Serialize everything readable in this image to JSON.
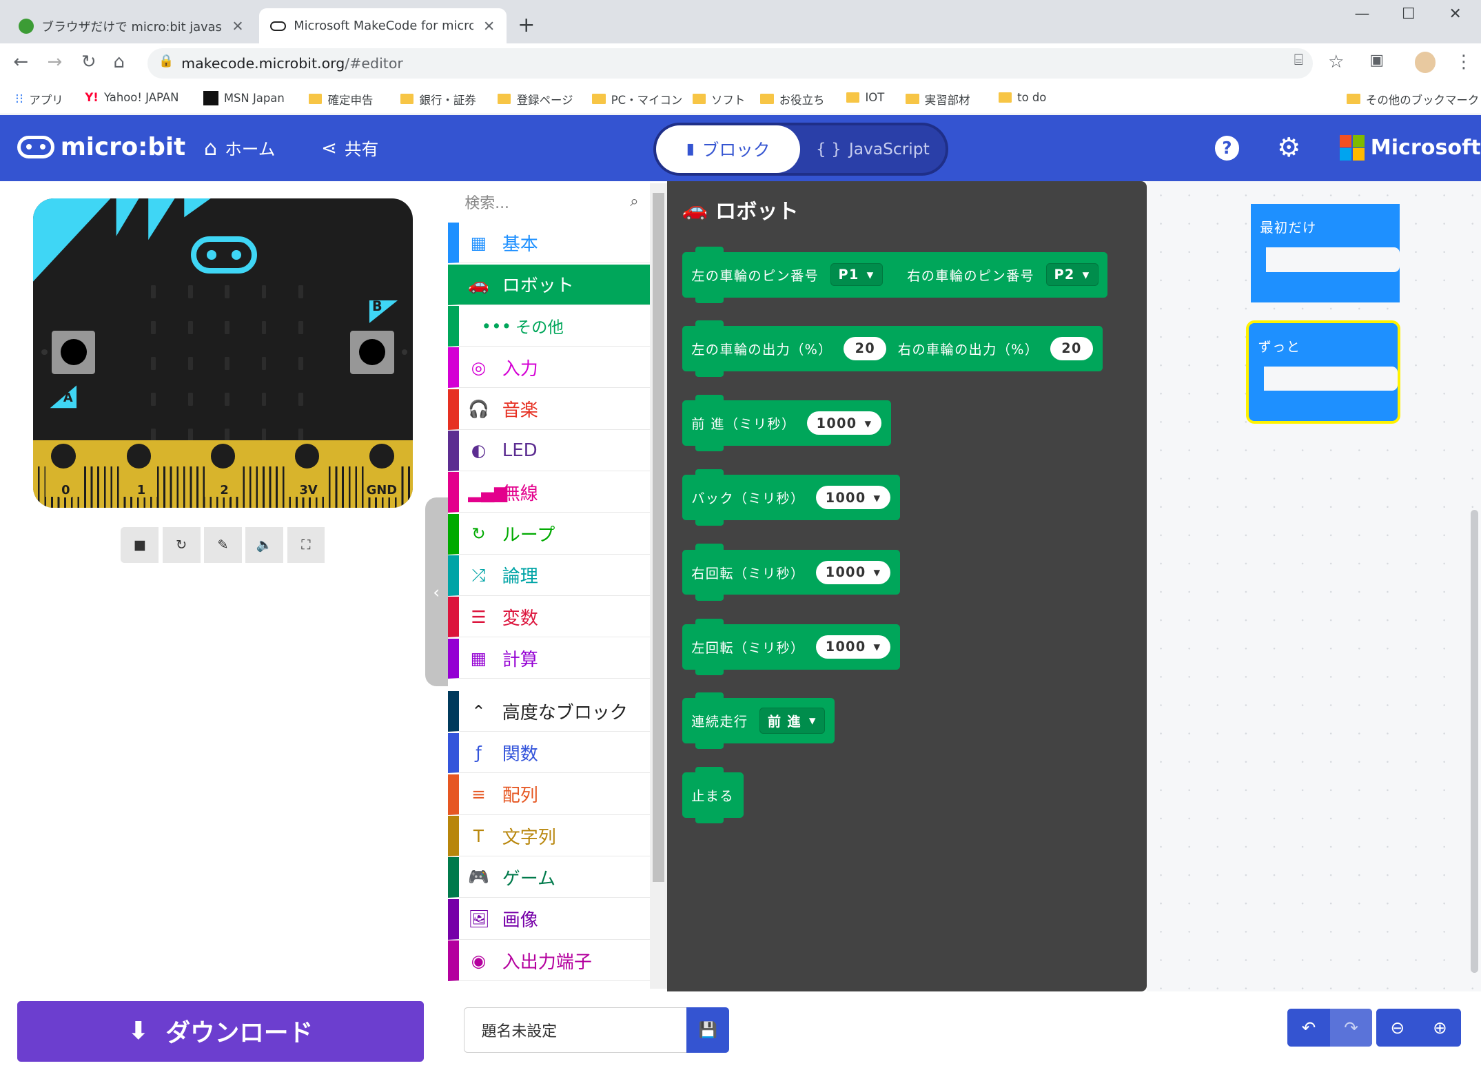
{
  "browser": {
    "tabs": [
      {
        "title": "ブラウザだけで micro:bit javascript",
        "close": "✕"
      },
      {
        "title": "Microsoft MakeCode for micro:bit",
        "close": "✕"
      }
    ],
    "new_tab": "+",
    "window_controls": {
      "minimize": "—",
      "maximize": "☐",
      "close": "✕"
    },
    "url_host": "makecode.microbit.org",
    "url_path": "/#editor",
    "bookmarks": [
      {
        "label": "アプリ"
      },
      {
        "label": "Yahoo! JAPAN"
      },
      {
        "label": "MSN Japan"
      },
      {
        "label": "確定申告"
      },
      {
        "label": "銀行・証券"
      },
      {
        "label": "登録ページ"
      },
      {
        "label": "PC・マイコン"
      },
      {
        "label": "ソフト"
      },
      {
        "label": "お役立ち"
      },
      {
        "label": "IOT"
      },
      {
        "label": "実習部材"
      },
      {
        "label": "to do"
      },
      {
        "label": "その他のブックマーク"
      }
    ]
  },
  "header": {
    "logo": "micro:bit",
    "home": "ホーム",
    "share": "共有",
    "blocks_tab": "ブロック",
    "js_tab": "JavaScript",
    "microsoft": "Microsoft",
    "colors": {
      "brand": "#3454d1"
    }
  },
  "simulator": {
    "button_a": "A",
    "button_b": "B",
    "pins": [
      "0",
      "1",
      "2",
      "3V",
      "GND"
    ]
  },
  "toolbox": {
    "search_placeholder": "検索...",
    "categories": [
      {
        "label": "基本",
        "color": "#1e90ff",
        "icon": "grid-icon"
      },
      {
        "label": "ロボット",
        "color": "#00a65a",
        "icon": "car-icon",
        "selected": true
      },
      {
        "label": "その他",
        "color": "#00a65a",
        "icon": "more-icon",
        "sub": true
      },
      {
        "label": "入力",
        "color": "#d400d4",
        "icon": "target-icon"
      },
      {
        "label": "音楽",
        "color": "#e63022",
        "icon": "headphones-icon"
      },
      {
        "label": "LED",
        "color": "#5c2d91",
        "icon": "toggle-icon"
      },
      {
        "label": "無線",
        "color": "#e3008c",
        "icon": "signal-icon"
      },
      {
        "label": "ループ",
        "color": "#00aa00",
        "icon": "refresh-icon"
      },
      {
        "label": "論理",
        "color": "#00a4a6",
        "icon": "shuffle-icon"
      },
      {
        "label": "変数",
        "color": "#dc143c",
        "icon": "list-icon"
      },
      {
        "label": "計算",
        "color": "#9400d3",
        "icon": "calculator-icon"
      },
      {
        "label": "高度なブロック",
        "color": "#003a5c",
        "icon": "chevron-up-icon"
      },
      {
        "label": "関数",
        "color": "#3455db",
        "icon": "function-icon"
      },
      {
        "label": "配列",
        "color": "#e65722",
        "icon": "ordered-list-icon"
      },
      {
        "label": "文字列",
        "color": "#b8860b",
        "icon": "text-icon"
      },
      {
        "label": "ゲーム",
        "color": "#007a4b",
        "icon": "gamepad-icon"
      },
      {
        "label": "画像",
        "color": "#7600a8",
        "icon": "image-icon"
      },
      {
        "label": "入出力端子",
        "color": "#b4009e",
        "icon": "pins-icon"
      }
    ]
  },
  "flyout": {
    "title": "ロボット",
    "blocks": [
      {
        "parts": [
          "左の車輪のピン番号",
          "P1",
          "右の車輪のピン番号",
          "P2"
        ]
      },
      {
        "parts": [
          "左の車輪の出力（%）",
          "20",
          "右の車輪の出力（%）",
          "20"
        ]
      },
      {
        "parts": [
          "前 進（ミリ秒）",
          "1000"
        ]
      },
      {
        "parts": [
          "バック（ミリ秒）",
          "1000"
        ]
      },
      {
        "parts": [
          "右回転（ミリ秒）",
          "1000"
        ]
      },
      {
        "parts": [
          "左回転（ミリ秒）",
          "1000"
        ]
      },
      {
        "parts": [
          "連続走行",
          "前 進"
        ]
      },
      {
        "parts": [
          "止まる"
        ]
      }
    ]
  },
  "workspace": {
    "on_start": "最初だけ",
    "forever": "ずっと"
  },
  "bottom": {
    "download": "ダウンロード",
    "project_name": "題名未設定"
  }
}
